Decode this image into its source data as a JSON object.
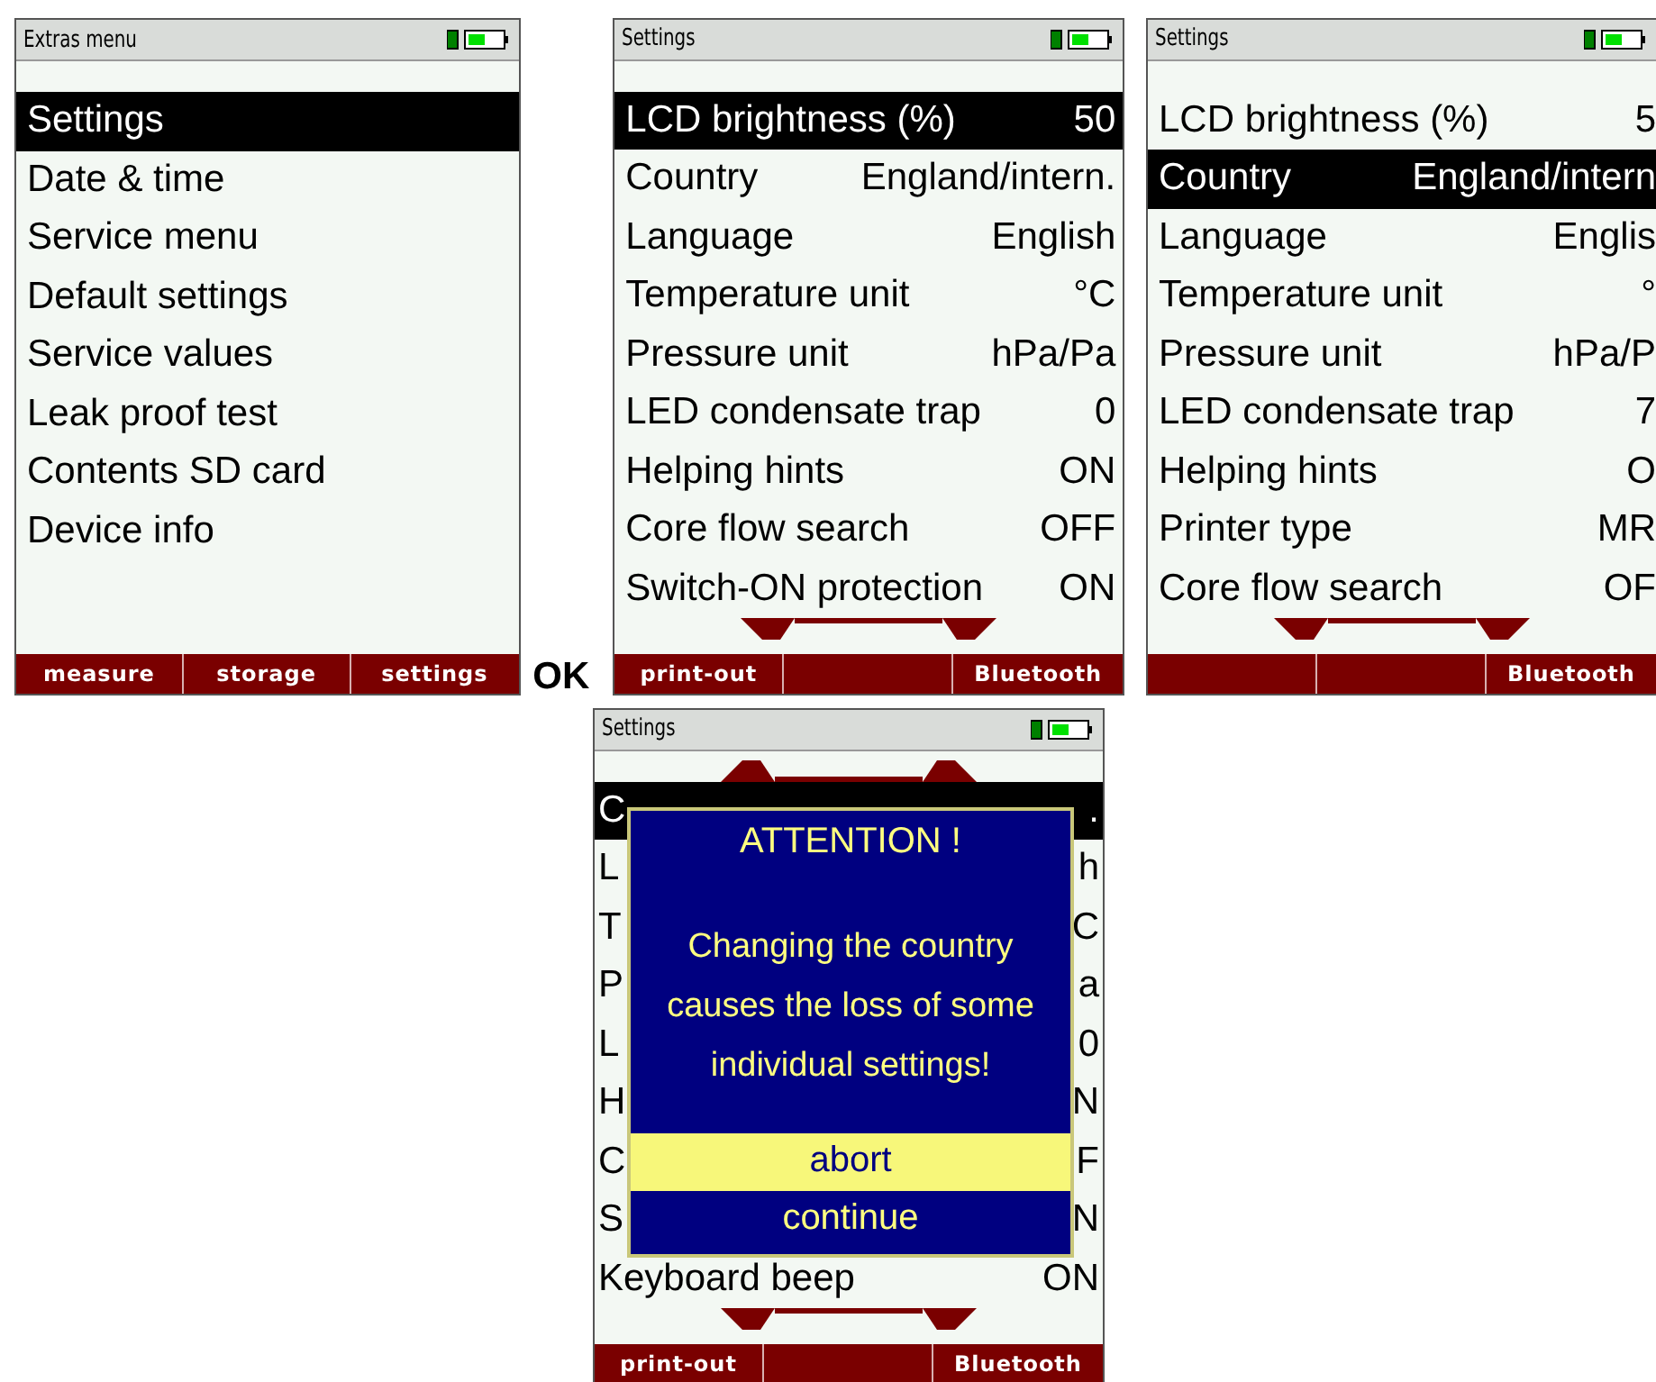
{
  "screens": [
    {
      "title": "Extras menu",
      "scroll_up": false,
      "scroll_down": false,
      "rows": [
        {
          "label": "Settings",
          "selected": true
        },
        {
          "label": "Date & time",
          "selected": false
        },
        {
          "label": "Service menu",
          "selected": false
        },
        {
          "label": "Default settings",
          "selected": false
        },
        {
          "label": "Service values",
          "selected": false
        },
        {
          "label": "Leak proof test",
          "selected": false
        },
        {
          "label": "Contents SD card",
          "selected": false
        },
        {
          "label": "Device info",
          "selected": false
        }
      ],
      "softkeys": {
        "left": "measure",
        "middle": "storage",
        "right": "settings"
      }
    },
    {
      "title": "Settings",
      "scroll_up": false,
      "scroll_down": true,
      "rows": [
        {
          "label": "LCD brightness (%)",
          "value": "50",
          "selected": true
        },
        {
          "label": "Country",
          "value": "England/intern.",
          "selected": false
        },
        {
          "label": "Language",
          "value": "English",
          "selected": false
        },
        {
          "label": "Temperature unit",
          "value": "°C",
          "selected": false
        },
        {
          "label": "Pressure unit",
          "value": "hPa/Pa",
          "selected": false
        },
        {
          "label": "LED condensate trap",
          "value": "0",
          "selected": false
        },
        {
          "label": "Helping hints",
          "value": "ON",
          "selected": false
        },
        {
          "label": "Core flow search",
          "value": "OFF",
          "selected": false
        },
        {
          "label": "Switch-ON protection",
          "value": "ON",
          "selected": false
        }
      ],
      "softkeys": {
        "left": "print-out",
        "right": "Bluetooth"
      }
    },
    {
      "title": "Settings",
      "scroll_up": false,
      "scroll_down": true,
      "rows": [
        {
          "label": "LCD brightness (%)",
          "value": "5",
          "selected": false
        },
        {
          "label": "Country",
          "value": "England/intern",
          "selected": true
        },
        {
          "label": "Language",
          "value": "Englis",
          "selected": false
        },
        {
          "label": "Temperature unit",
          "value": "°",
          "selected": false
        },
        {
          "label": "Pressure unit",
          "value": "hPa/P",
          "selected": false
        },
        {
          "label": "LED condensate trap",
          "value": "7",
          "selected": false
        },
        {
          "label": "Helping hints",
          "value": "O",
          "selected": false
        },
        {
          "label": "Printer type",
          "value": "MR",
          "selected": false
        },
        {
          "label": "Core flow search",
          "value": "OF",
          "selected": false
        }
      ],
      "softkeys": {
        "right": "Bluetooth"
      }
    },
    {
      "title": "Settings",
      "scroll_up": true,
      "scroll_down": true,
      "rows": [
        {
          "label": "C",
          "value": ".",
          "selected": true
        },
        {
          "label": "L",
          "value": "h",
          "selected": false
        },
        {
          "label": "T",
          "value": "C",
          "selected": false
        },
        {
          "label": "P",
          "value": "a",
          "selected": false
        },
        {
          "label": "L",
          "value": "0",
          "selected": false
        },
        {
          "label": "H",
          "value": "N",
          "selected": false
        },
        {
          "label": "C",
          "value": "F",
          "selected": false
        },
        {
          "label": "S",
          "value": "N",
          "selected": false
        },
        {
          "label": "Keyboard beep",
          "value": "ON",
          "selected": false
        }
      ],
      "softkeys": {
        "left": "print-out",
        "right": "Bluetooth"
      },
      "dialog": {
        "title": "ATTENTION !",
        "message": "Changing the country causes the loss of some individual settings!",
        "options": [
          {
            "label": "abort",
            "selected": true
          },
          {
            "label": "continue",
            "selected": false
          }
        ]
      }
    }
  ],
  "ok_label": "OK"
}
